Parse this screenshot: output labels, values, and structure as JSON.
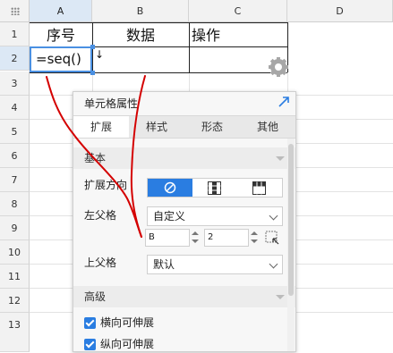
{
  "columns": [
    "A",
    "B",
    "C",
    "D"
  ],
  "rows": [
    "1",
    "2",
    "3",
    "4",
    "5",
    "6",
    "7",
    "8",
    "9",
    "10",
    "11",
    "12",
    "13"
  ],
  "cells": {
    "a1": "序号",
    "b1": "数据",
    "c1": "操作",
    "a2": "=seq()",
    "b2": "↓"
  },
  "panel": {
    "title": "单元格属性",
    "tabs": [
      "扩展",
      "样式",
      "形态",
      "其他"
    ],
    "section_basic": "基本",
    "expand_direction_label": "扩展方向",
    "left_parent_label": "左父格",
    "left_parent_value": "自定义",
    "left_parent_col": "B",
    "left_parent_row": "2",
    "top_parent_label": "上父格",
    "top_parent_value": "默认",
    "section_advanced": "高级",
    "horizontal_extend_label": "横向可伸展",
    "vertical_extend_label": "纵向可伸展",
    "horizontal_extend_checked": true,
    "vertical_extend_checked": true
  },
  "colors": {
    "accent": "#2a7de1",
    "selection": "#4a90e2",
    "annotation": "#d40000"
  }
}
